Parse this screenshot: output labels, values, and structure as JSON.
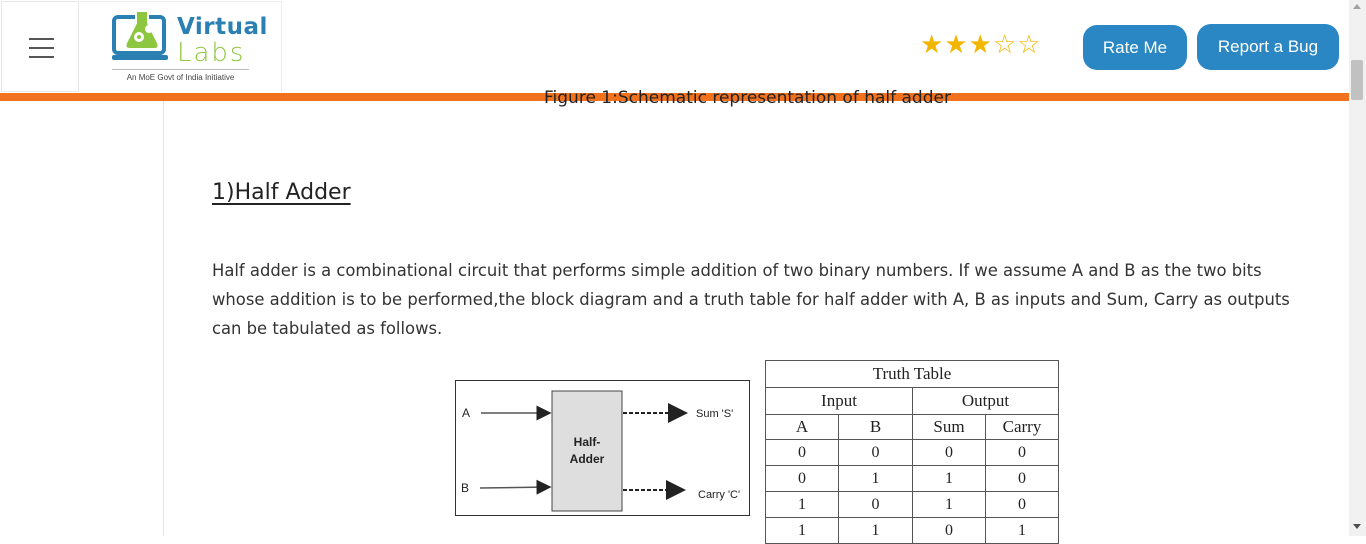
{
  "header": {
    "logo": {
      "word1": "Virtual",
      "word2": "Labs",
      "tagline": "An MoE Govt of India Initiative"
    },
    "rating": {
      "value": 3,
      "max": 5
    },
    "rate_button": "Rate Me",
    "bug_button": "Report a Bug"
  },
  "content": {
    "figure_caption_cut": "Figure 1:Schematic representation of half adder",
    "section_title": "1)Half Adder",
    "paragraph": "Half adder is a combinational circuit that performs simple addition of two binary numbers. If we assume A and B as the two bits whose addition is to be performed,the block diagram and a truth table for half adder with A, B as inputs and Sum, Carry as outputs can be tabulated as follows."
  },
  "diagram": {
    "input_a": "A",
    "input_b": "B",
    "block_line1": "Half-",
    "block_line2": "Adder",
    "output_sum": "Sum 'S'",
    "output_carry": "Carry 'C'"
  },
  "truth_table": {
    "title": "Truth Table",
    "group_input": "Input",
    "group_output": "Output",
    "columns": [
      "A",
      "B",
      "Sum",
      "Carry"
    ],
    "rows": [
      [
        "0",
        "0",
        "0",
        "0"
      ],
      [
        "0",
        "1",
        "1",
        "0"
      ],
      [
        "1",
        "0",
        "1",
        "0"
      ],
      [
        "1",
        "1",
        "0",
        "1"
      ]
    ]
  },
  "colors": {
    "accent_orange": "#f2711c",
    "button_blue": "#2a87c3",
    "star": "#f2b600"
  }
}
